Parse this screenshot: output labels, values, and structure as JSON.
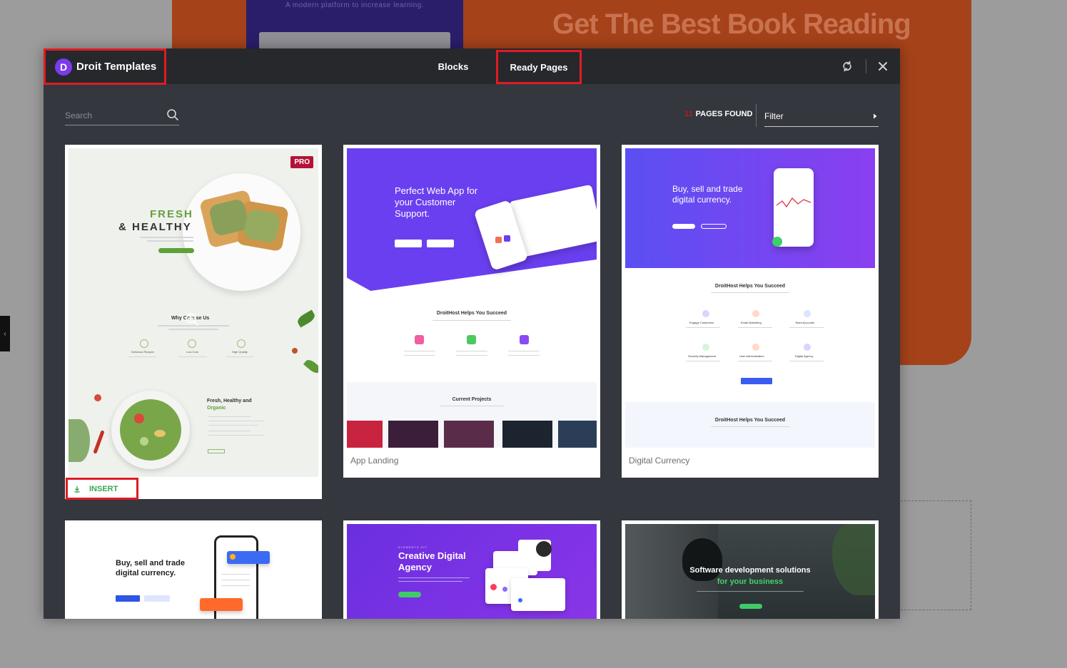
{
  "background": {
    "promo_text": "A modern platform to increase learning.",
    "heading": "Get The Best Book Reading"
  },
  "header": {
    "brand": "Droit Templates",
    "tabs": [
      {
        "label": "Blocks"
      },
      {
        "label": "Ready Pages"
      }
    ]
  },
  "toolbar": {
    "search_placeholder": "Search",
    "pages_found_count": "11",
    "pages_found_label": "PAGES FOUND",
    "filter_label": "Filter"
  },
  "cards": [
    {
      "title": "",
      "badge": "PRO",
      "insert_label": "INSERT",
      "thumb": {
        "heading_line1": "FRESH",
        "heading_line2": "& HEALTHY",
        "section_title": "Why Choose Us",
        "features": [
          "Delicious Recipes",
          "Low Cost",
          "High Quality"
        ],
        "side_title_1": "Fresh, Healthy and",
        "side_title_2": "Organic"
      }
    },
    {
      "title": "App Landing",
      "thumb": {
        "hero": "Perfect Web App for your Customer Support.",
        "section": "DroitHost Helps You Succeed",
        "projects": "Current Projects"
      }
    },
    {
      "title": "Digital Currency",
      "thumb": {
        "hero": "Buy, sell and trade digital currency.",
        "section": "DroitHost Helps You Succeed",
        "features": [
          "Engage Customers",
          "Email Marketing",
          "Team Accounts",
          "Security Management",
          "User Administration",
          "Digital Agency"
        ],
        "section2": "DroitHost Helps You Succeed"
      }
    },
    {
      "title": "",
      "thumb": {
        "hero": "Buy, sell and trade digital currency."
      }
    },
    {
      "title": "",
      "thumb": {
        "eyebrow": "ELEMENTS KIT",
        "hero": "Creative Digital Agency"
      }
    },
    {
      "title": "",
      "thumb": {
        "hero": "Software development solutions",
        "highlight": "for your business"
      }
    }
  ],
  "colors": {
    "accent_red": "#e01b24",
    "brand_purple": "#7c3aed",
    "insert_green": "#3aa655",
    "modal_bg": "#34373d",
    "header_bg": "#26282c"
  }
}
